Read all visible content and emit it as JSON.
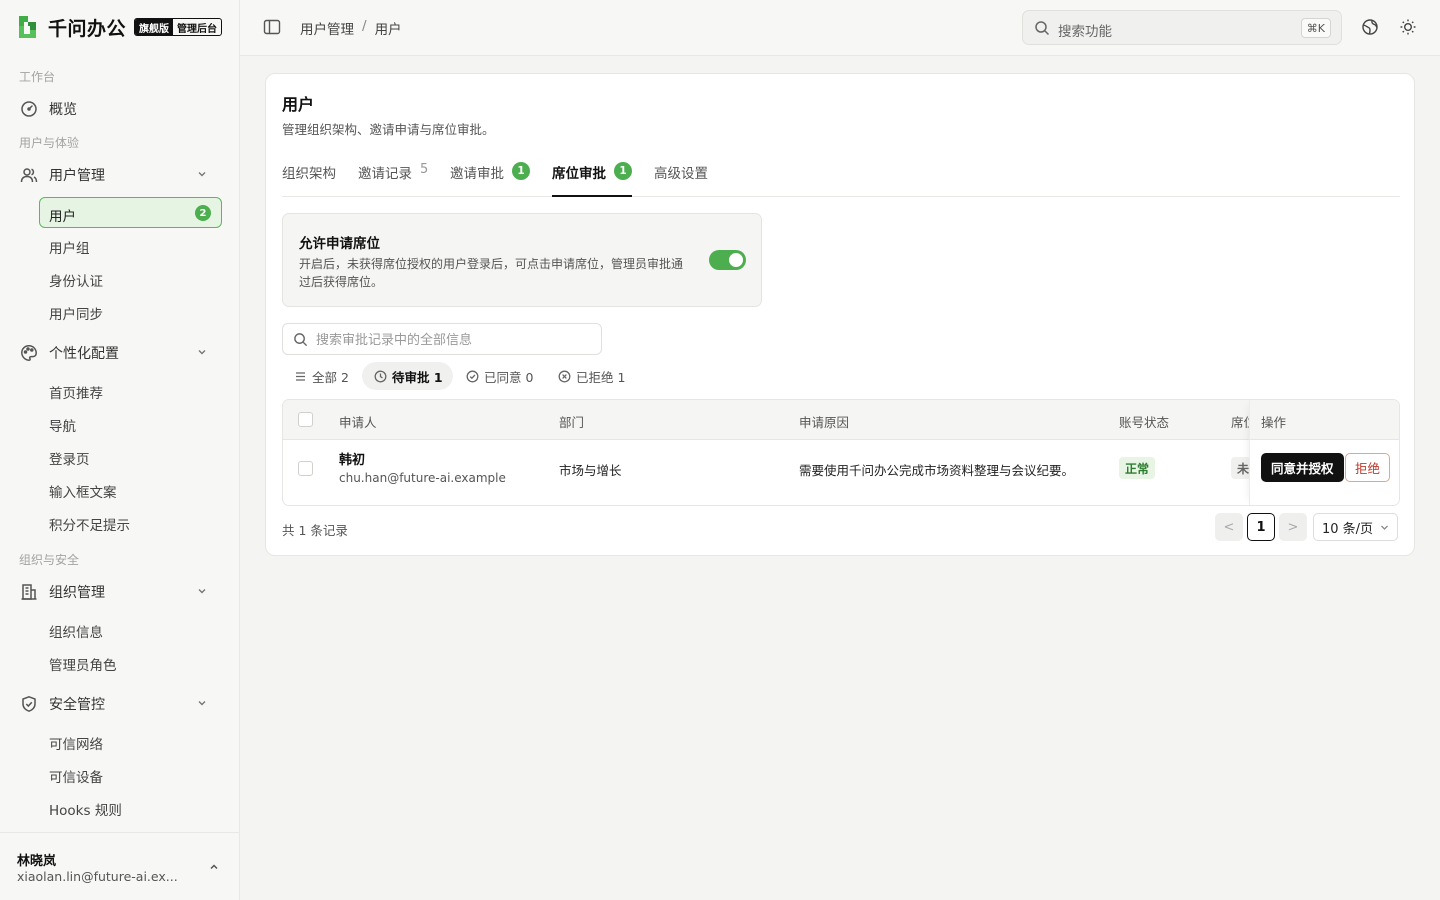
{
  "brand": {
    "name": "千问办公",
    "badge_primary": "旗舰版",
    "badge_secondary": "管理后台"
  },
  "sidebar": {
    "sections": [
      "工作台",
      "用户与体验",
      "组织与安全"
    ],
    "overview": "概览",
    "user_mgmt": {
      "label": "用户管理",
      "items": [
        "用户",
        "用户组",
        "身份认证",
        "用户同步"
      ],
      "active_badge": "2"
    },
    "personalize": {
      "label": "个性化配置",
      "items": [
        "首页推荐",
        "导航",
        "登录页",
        "输入框文案",
        "积分不足提示"
      ]
    },
    "org_mgmt": {
      "label": "组织管理",
      "items": [
        "组织信息",
        "管理员角色"
      ]
    },
    "security": {
      "label": "安全管控",
      "items": [
        "可信网络",
        "可信设备",
        "Hooks 规则"
      ]
    },
    "account": {
      "name": "林晓岚",
      "email": "xiaolan.lin@future-ai.ex..."
    }
  },
  "topbar": {
    "breadcrumb": [
      "用户管理",
      "用户"
    ],
    "breadcrumb_sep": "/",
    "search_placeholder": "搜索功能",
    "search_shortcut": "⌘K"
  },
  "page": {
    "title": "用户",
    "description": "管理组织架构、邀请申请与席位审批。",
    "tabs": [
      {
        "label": "组织架构"
      },
      {
        "label": "邀请记录",
        "count": "5"
      },
      {
        "label": "邀请审批",
        "badge": "1"
      },
      {
        "label": "席位审批",
        "badge": "1",
        "active": true
      },
      {
        "label": "高级设置"
      }
    ]
  },
  "seat_setting": {
    "title": "允许申请席位",
    "description": "开启后，未获得席位授权的用户登录后，可点击申请席位，管理员审批通过后获得席位。",
    "enabled": true
  },
  "records": {
    "search_placeholder": "搜索审批记录中的全部信息",
    "filters": [
      {
        "label": "全部 2"
      },
      {
        "label": "待审批 1",
        "active": true
      },
      {
        "label": "已同意 0"
      },
      {
        "label": "已拒绝 1"
      }
    ],
    "columns": [
      "申请人",
      "部门",
      "申请原因",
      "账号状态",
      "席位",
      "操作"
    ],
    "rows": [
      {
        "name": "韩初",
        "email": "chu.han@future-ai.example",
        "department": "市场与增长",
        "reason": "需要使用千问办公完成市场资料整理与会议纪要。",
        "account_status": "正常",
        "seat_status": "未",
        "approve_label": "同意并授权",
        "reject_label": "拒绝"
      }
    ],
    "total_text": "共 1 条记录",
    "pagination": {
      "current_page": "1",
      "page_size": "10 条/页",
      "prev": "<",
      "next": ">"
    }
  },
  "colors": {
    "accent_green": "#4cae4f",
    "text_primary": "#111111",
    "danger": "#c0392b"
  }
}
